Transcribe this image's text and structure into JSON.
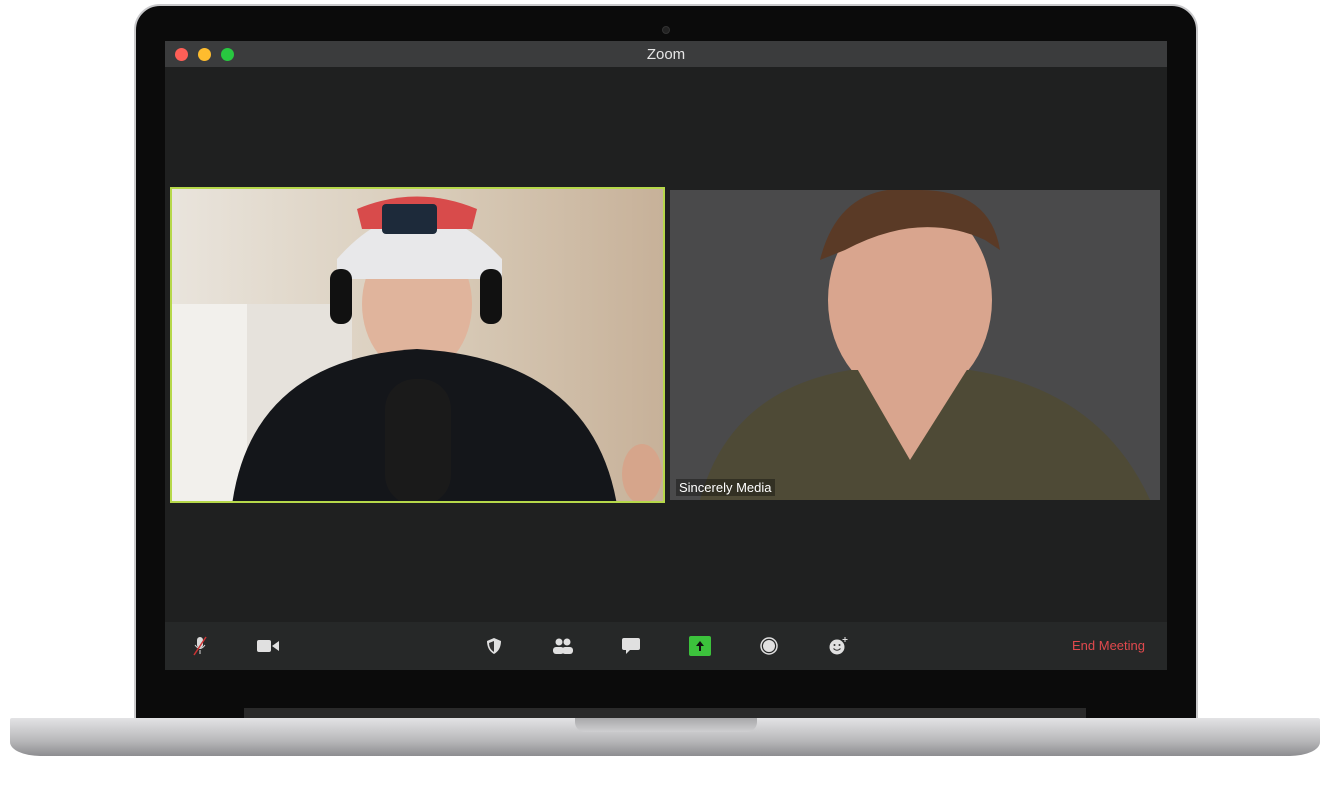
{
  "window": {
    "title": "Zoom",
    "lights": [
      "#fe5f57",
      "#febc2e",
      "#28c840"
    ]
  },
  "participants": [
    {
      "name": "",
      "active": true,
      "highlight": "#b6d84a"
    },
    {
      "name": "Sincerely Media",
      "active": false
    }
  ],
  "toolbar": {
    "items": [
      "mute-microphone",
      "start-video",
      "security",
      "participants",
      "chat",
      "share-screen",
      "record",
      "reactions"
    ],
    "share_color": "#3cc23c",
    "end_label": "End Meeting",
    "end_color": "#e0494d"
  }
}
